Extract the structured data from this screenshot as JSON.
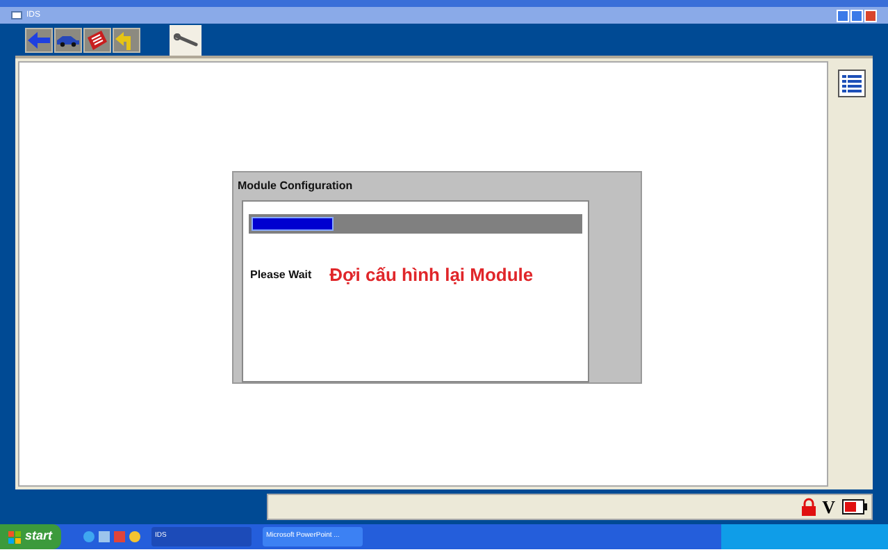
{
  "window": {
    "title": "IDS"
  },
  "toolbar": {
    "tabs": [
      {
        "kind": "back",
        "selected": false
      },
      {
        "kind": "vehicle",
        "selected": false
      },
      {
        "kind": "toolbox",
        "selected": false
      },
      {
        "kind": "shortcut",
        "selected": false
      },
      {
        "kind": "wrench",
        "selected": true
      }
    ]
  },
  "dialog": {
    "title": "Module Configuration",
    "progress": {
      "level": 0.25
    },
    "message": "Please Wait",
    "annotation": "Đợi cấu hình lại Module"
  },
  "status_bar": {
    "voltage_label": "V"
  },
  "taskbar": {
    "start": "start",
    "tasks": [
      {
        "label": "IDS",
        "selected": true
      },
      {
        "label": "Microsoft PowerPoint ...",
        "selected": false
      }
    ]
  }
}
